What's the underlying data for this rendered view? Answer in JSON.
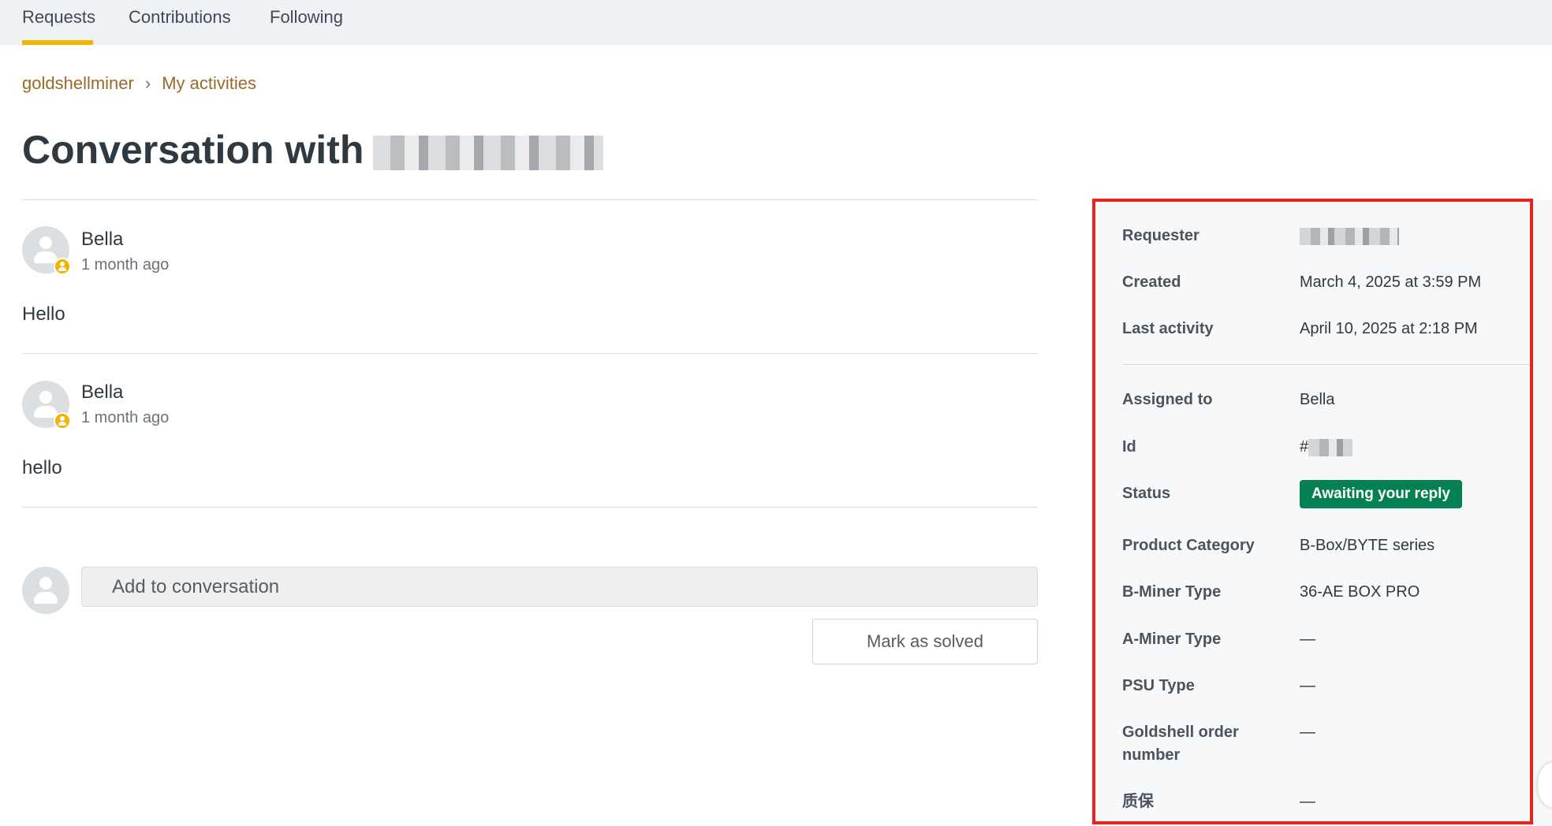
{
  "tabs": [
    {
      "label": "Requests",
      "active": true
    },
    {
      "label": "Contributions",
      "active": false
    },
    {
      "label": "Following",
      "active": false
    }
  ],
  "breadcrumb": {
    "items": [
      "goldshellminer",
      "My activities"
    ],
    "separator": "›"
  },
  "title": {
    "prefix": "Conversation with"
  },
  "comments": [
    {
      "author": "Bella",
      "time": "1 month ago",
      "text": "Hello"
    },
    {
      "author": "Bella",
      "time": "1 month ago",
      "text": "hello"
    }
  ],
  "reply": {
    "placeholder": "Add to conversation",
    "solve_label": "Mark as solved"
  },
  "details": {
    "requester_label": "Requester",
    "created_label": "Created",
    "created_value": "March 4, 2025 at 3:59 PM",
    "last_activity_label": "Last activity",
    "last_activity_value": "April 10, 2025 at 2:18 PM",
    "assigned_label": "Assigned to",
    "assigned_value": "Bella",
    "id_label": "Id",
    "id_prefix": "#",
    "status_label": "Status",
    "status_value": "Awaiting your reply",
    "product_category_label": "Product Category",
    "product_category_value": "B-Box/BYTE series",
    "bminer_label": "B-Miner Type",
    "bminer_value": "36-AE BOX PRO",
    "aminer_label": "A-Miner Type",
    "aminer_value": "—",
    "psu_label": "PSU Type",
    "psu_value": "—",
    "order_label": "Goldshell order number",
    "order_value": "—",
    "warranty_label": "质保",
    "warranty_value": "—"
  },
  "colors": {
    "accent": "#f2b400",
    "link": "#9a6a28",
    "status_green": "#038153",
    "highlight_red": "#e8241d"
  }
}
